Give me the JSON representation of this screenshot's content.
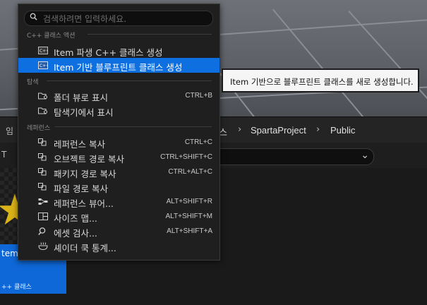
{
  "menu": {
    "search_placeholder": "검색하려면 입력하세요.",
    "sections": {
      "cpp": "C++ 클래스 액션",
      "explorer": "탐색",
      "reference": "레퍼런스"
    },
    "items": [
      {
        "label": "Item 파생 C++ 클래스 생성",
        "shortcut": "",
        "icon": "cpp-class-icon"
      },
      {
        "label": "Item 기반 블루프린트 클래스 생성",
        "shortcut": "",
        "icon": "blueprint-class-icon"
      },
      {
        "label": "폴더 뷰로 표시",
        "shortcut": "CTRL+B",
        "icon": "folder-search-icon"
      },
      {
        "label": "탐색기에서 표시",
        "shortcut": "",
        "icon": "explorer-folder-icon"
      },
      {
        "label": "레퍼런스 복사",
        "shortcut": "CTRL+C",
        "icon": "copy-icon"
      },
      {
        "label": "오브젝트 경로 복사",
        "shortcut": "CTRL+SHIFT+C",
        "icon": "copy-icon"
      },
      {
        "label": "패키지 경로 복사",
        "shortcut": "CTRL+ALT+C",
        "icon": "copy-icon"
      },
      {
        "label": "파일 경로 복사",
        "shortcut": "",
        "icon": "copy-icon"
      },
      {
        "label": "레퍼런스 뷰어...",
        "shortcut": "ALT+SHIFT+R",
        "icon": "reference-viewer-icon"
      },
      {
        "label": "사이즈 맵...",
        "shortcut": "ALT+SHIFT+M",
        "icon": "size-map-icon"
      },
      {
        "label": "에셋 검사...",
        "shortcut": "ALT+SHIFT+A",
        "icon": "asset-audit-icon"
      },
      {
        "label": "셰이더 쿡 통계...",
        "shortcut": "",
        "icon": "shader-cook-icon"
      }
    ]
  },
  "tooltip": "Item 기반으로 블루프린트 클래스를 새로 생성합니다.",
  "breadcrumb": {
    "partial": "스",
    "project": "SpartaProject",
    "folder": "Public"
  },
  "tile": {
    "name": "tem",
    "class_label": "++ 클래스"
  },
  "partials": {
    "left_top": "임",
    "left_filter": "T"
  },
  "colors": {
    "highlight": "#0e70e0",
    "tile_blue": "#0e68d8",
    "star": "#d9b318"
  }
}
